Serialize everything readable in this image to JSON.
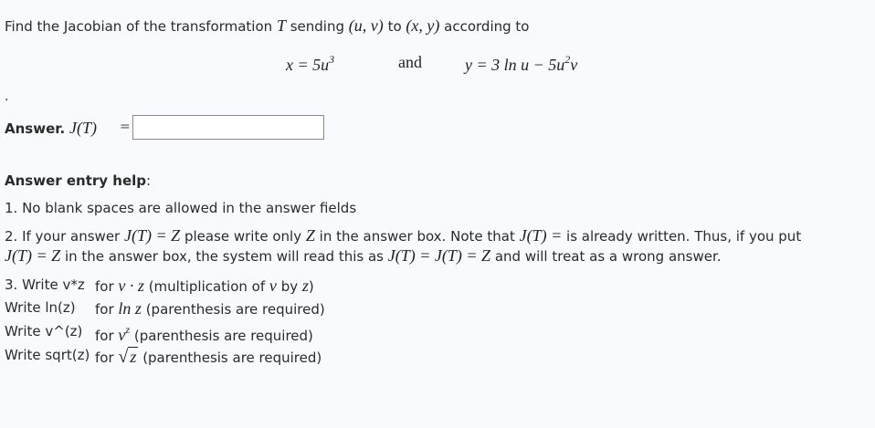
{
  "problem": {
    "intro_prefix": "Find the Jacobian of the transformation",
    "intro_T": "T",
    "intro_middle": "sending",
    "intro_from": "(u, v)",
    "intro_to_word": "to",
    "intro_to": "(x, y)",
    "intro_suffix": "according to",
    "eq_x": "x = 5u",
    "eq_x_exp": "3",
    "and_word": "and",
    "eq_y_prefix": "y = 3 ln u − 5u",
    "eq_y_exp": "2",
    "eq_y_suffix": "v",
    "dot": "."
  },
  "answer": {
    "label": "Answer.",
    "jt": "J(T)",
    "equals": "=",
    "value": ""
  },
  "help": {
    "title": "Answer entry help",
    "colon": ":",
    "item1": "1. No blank spaces are allowed in the answer fields",
    "item2_a": "2. If your answer",
    "item2_jtz": "J(T) = Z",
    "item2_b": "please write only",
    "item2_z": "Z",
    "item2_c": "in the answer box. Note that",
    "item2_jt": "J(T) =",
    "item2_d": "is already written. Thus, if you put",
    "item2_e_jtz": "J(T) = Z",
    "item2_f": "in the answer box, the system will read this as",
    "item2_g": "J(T) = J(T) = Z",
    "item2_h": "and will treat as a wrong answer.",
    "r1_code": "3. Write v*z",
    "r1_for": "for",
    "r1_math": "v · z",
    "r1_desc_a": "(multiplication of",
    "r1_v": "v",
    "r1_by": "by",
    "r1_z": "z",
    "r1_close": ")",
    "r2_code": "Write ln(z)",
    "r2_for": "for",
    "r2_math": "ln z",
    "r2_desc": "(parenthesis are required)",
    "r3_code": "Write v^(z)",
    "r3_for": "for",
    "r3_base": "v",
    "r3_exp": "z",
    "r3_desc": "(parenthesis are required)",
    "r4_code": "Write sqrt(z)",
    "r4_for": "for",
    "r4_sqrt": "√",
    "r4_arg": "z",
    "r4_desc": "(parenthesis are required)"
  }
}
